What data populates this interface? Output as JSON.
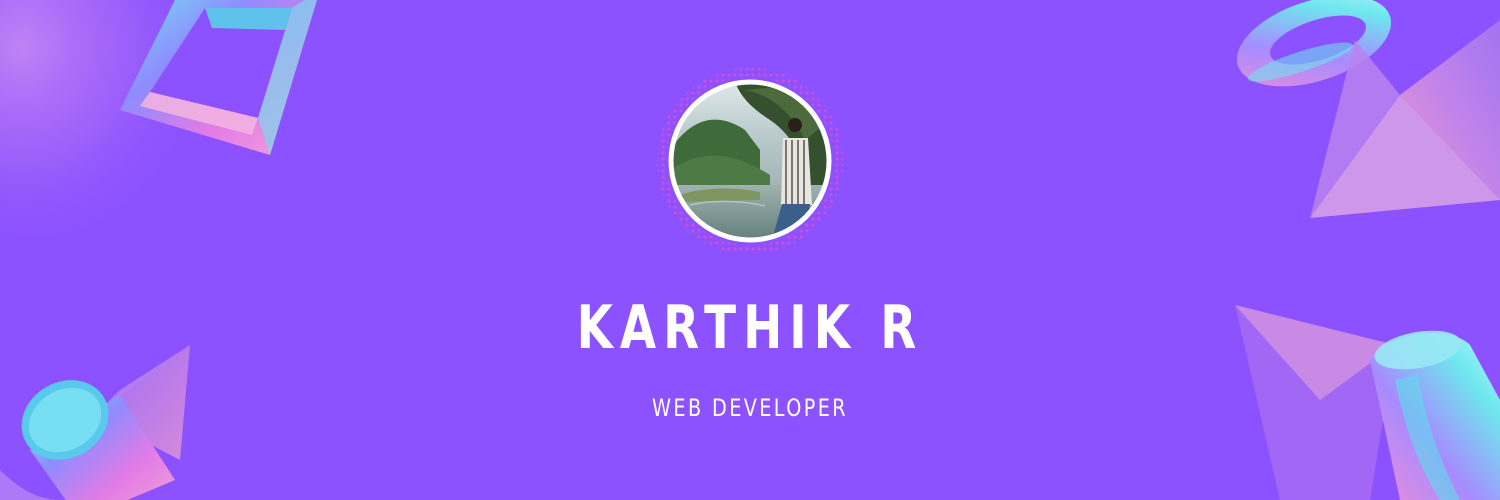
{
  "profile": {
    "name": "KARTHIK R",
    "title": "WEB DEVELOPER"
  },
  "colors": {
    "background": "#8c52ff",
    "text": "#ffffff",
    "accent_pink": "#e85bd6",
    "accent_cyan": "#5fe3f0"
  },
  "icons": {
    "decor_top_left": "frame-shape-icon",
    "decor_top_right": "torus-ring-icon",
    "decor_bottom_left": "cylinder-icon",
    "decor_bottom_right": "cylinder-icon"
  }
}
